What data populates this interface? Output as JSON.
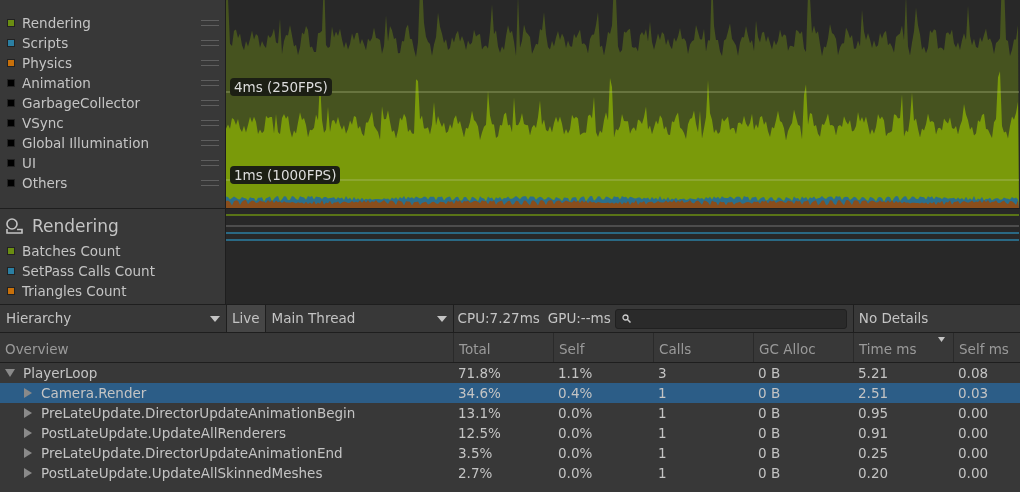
{
  "cpu_usage": {
    "legend": [
      {
        "label": "Rendering",
        "color": "#6b8e12"
      },
      {
        "label": "Scripts",
        "color": "#2b7fa3"
      },
      {
        "label": "Physics",
        "color": "#c8700a"
      },
      {
        "label": "Animation",
        "color": "#000000"
      },
      {
        "label": "GarbageCollector",
        "color": "#000000"
      },
      {
        "label": "VSync",
        "color": "#000000"
      },
      {
        "label": "Global Illumination",
        "color": "#000000"
      },
      {
        "label": "UI",
        "color": "#000000"
      },
      {
        "label": "Others",
        "color": "#000000"
      }
    ],
    "markers": [
      {
        "label": "4ms (250FPS)"
      },
      {
        "label": "1ms (1000FPS)"
      }
    ]
  },
  "rendering": {
    "title": "Rendering",
    "legend": [
      {
        "label": "Batches Count",
        "color": "#6b8e12"
      },
      {
        "label": "SetPass Calls Count",
        "color": "#2b7fa3"
      },
      {
        "label": "Triangles Count",
        "color": "#c8700a"
      }
    ]
  },
  "toolbar": {
    "view": "Hierarchy",
    "live": "Live",
    "thread": "Main Thread",
    "cpu": "CPU:7.27ms",
    "gpu": "GPU:--ms",
    "details": "No Details"
  },
  "table": {
    "columns": [
      {
        "label": "Overview",
        "sorted": false
      },
      {
        "label": "Total",
        "sorted": false
      },
      {
        "label": "Self",
        "sorted": false
      },
      {
        "label": "Calls",
        "sorted": false
      },
      {
        "label": "GC Alloc",
        "sorted": false
      },
      {
        "label": "Time ms",
        "sorted": true
      },
      {
        "label": "Self ms",
        "sorted": false
      }
    ],
    "rows": [
      {
        "cells": [
          "PlayerLoop",
          "71.8%",
          "1.1%",
          "3",
          "0 B",
          "5.21",
          "0.08"
        ],
        "expanded": true,
        "selected": false,
        "children": [
          {
            "cells": [
              "Camera.Render",
              "34.6%",
              "0.4%",
              "1",
              "0 B",
              "2.51",
              "0.03"
            ],
            "expanded": false,
            "selected": true
          },
          {
            "cells": [
              "PreLateUpdate.DirectorUpdateAnimationBegin",
              "13.1%",
              "0.0%",
              "1",
              "0 B",
              "0.95",
              "0.00"
            ],
            "expanded": false,
            "selected": false
          },
          {
            "cells": [
              "PostLateUpdate.UpdateAllRenderers",
              "12.5%",
              "0.0%",
              "1",
              "0 B",
              "0.91",
              "0.00"
            ],
            "expanded": false,
            "selected": false
          },
          {
            "cells": [
              "PreLateUpdate.DirectorUpdateAnimationEnd",
              "3.5%",
              "0.0%",
              "1",
              "0 B",
              "0.25",
              "0.00"
            ],
            "expanded": false,
            "selected": false
          },
          {
            "cells": [
              "PostLateUpdate.UpdateAllSkinnedMeshes",
              "2.7%",
              "0.0%",
              "1",
              "0 B",
              "0.20",
              "0.00"
            ],
            "expanded": false,
            "selected": false
          }
        ]
      }
    ]
  }
}
